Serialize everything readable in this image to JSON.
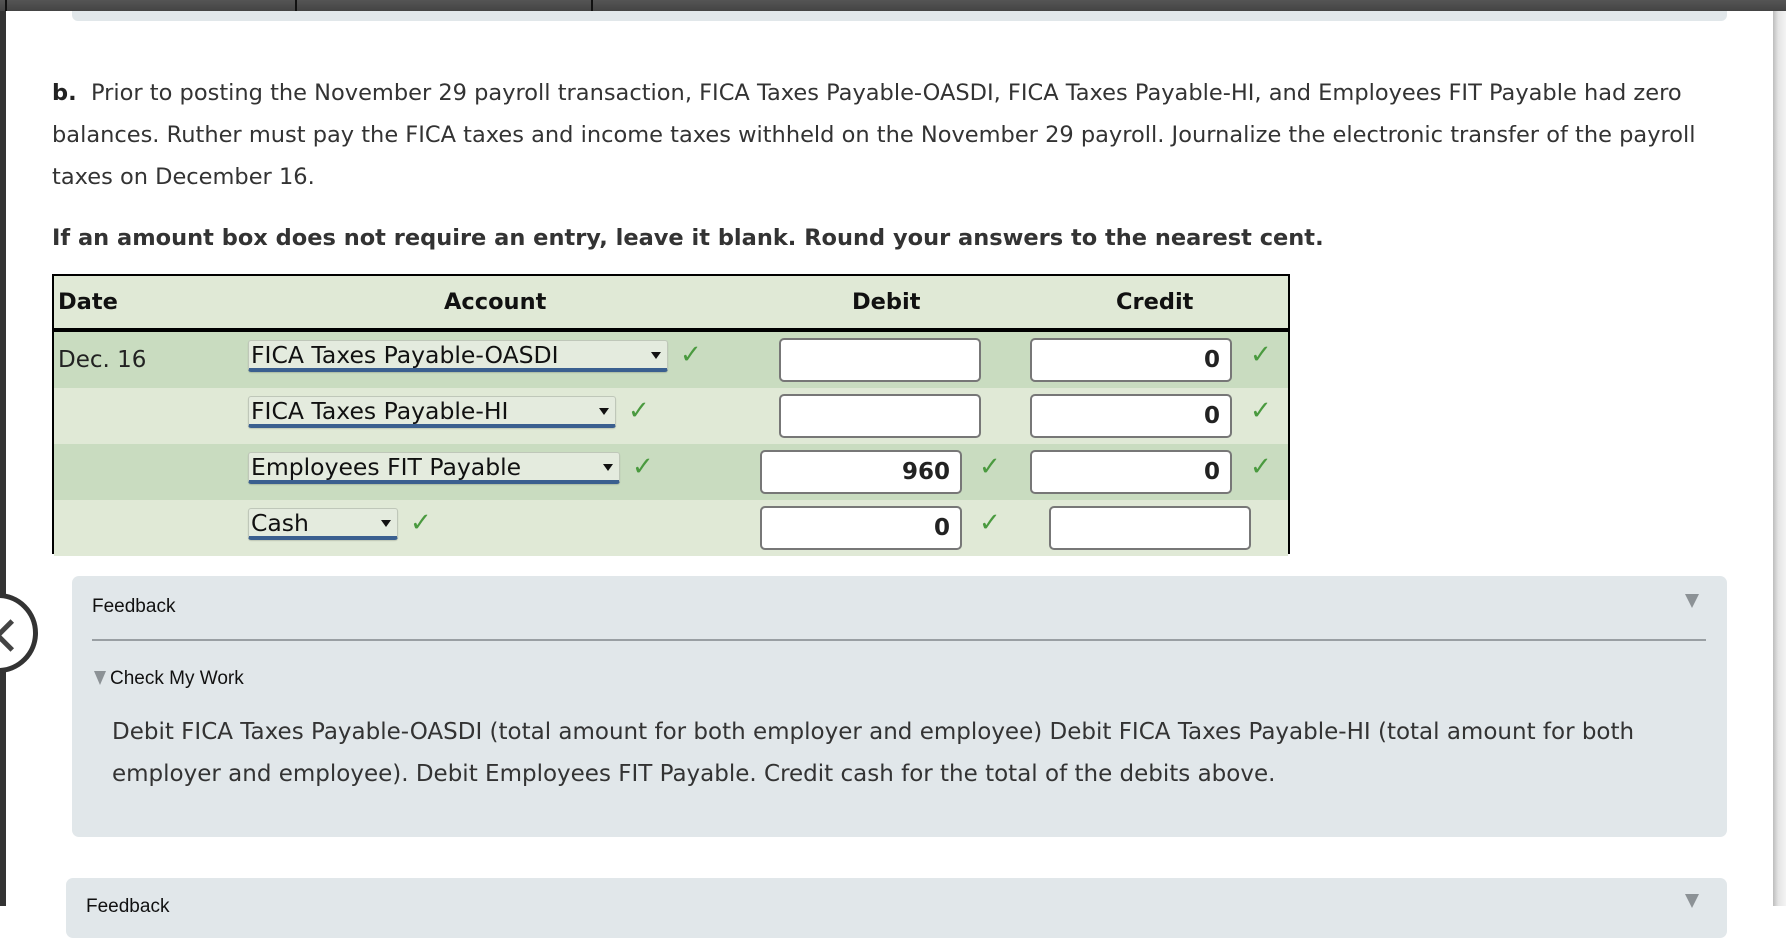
{
  "question": {
    "part_label": "b.",
    "prompt": "Prior to posting the November 29 payroll transaction, FICA Taxes Payable-OASDI, FICA Taxes Payable-HI, and Employees FIT Payable had zero balances. Ruther must pay the FICA taxes and income taxes withheld on the November 29 payroll. Journalize the electronic transfer of the payroll taxes on December 16.",
    "instruction": "If an amount box does not require an entry, leave it blank. Round your answers to the nearest cent."
  },
  "journal": {
    "headers": {
      "date": "Date",
      "account": "Account",
      "debit": "Debit",
      "credit": "Credit"
    },
    "rows": [
      {
        "date": "Dec. 16",
        "account": "FICA Taxes Payable-OASDI",
        "account_correct": true,
        "debit": "",
        "debit_correct": null,
        "credit": "0",
        "credit_correct": true
      },
      {
        "date": "",
        "account": "FICA Taxes Payable-HI",
        "account_correct": true,
        "debit": "",
        "debit_correct": null,
        "credit": "0",
        "credit_correct": true
      },
      {
        "date": "",
        "account": "Employees FIT Payable",
        "account_correct": true,
        "debit": "960",
        "debit_correct": true,
        "credit": "0",
        "credit_correct": true
      },
      {
        "date": "",
        "account": "Cash",
        "account_correct": true,
        "debit": "0",
        "debit_correct": true,
        "credit": "",
        "credit_correct": null
      }
    ]
  },
  "feedback": {
    "title": "Feedback",
    "section_label": "Check My Work",
    "text": "Debit FICA Taxes Payable-OASDI (total amount for both employer and employee) Debit FICA Taxes Payable-HI (total amount for both employer and employee). Debit Employees FIT Payable. Credit cash for the total of the debits above."
  },
  "feedback2": {
    "title": "Feedback"
  },
  "icons": {
    "check": "✓",
    "correct_color": "#4a9a3f"
  }
}
